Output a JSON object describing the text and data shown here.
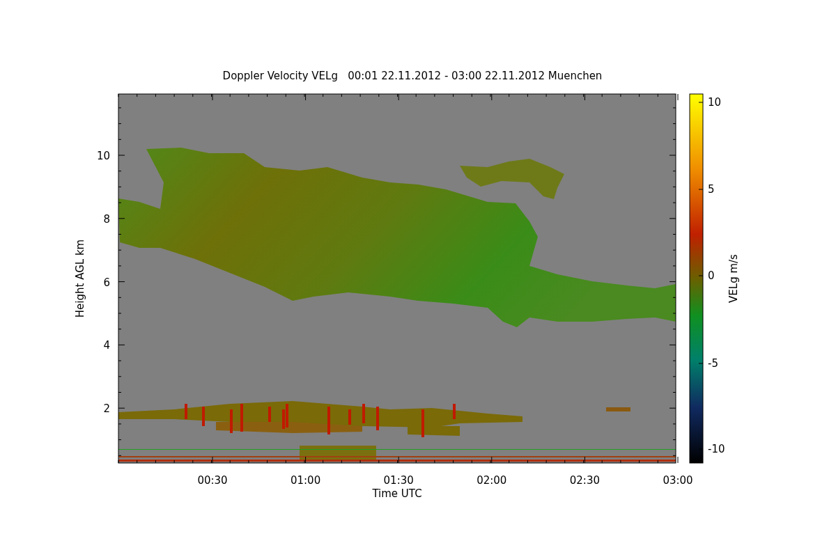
{
  "title": "Doppler Velocity VELg   00:01 22.11.2012 - 03:00 22.11.2012 Muenchen",
  "y_axis": {
    "label": "Height AGL km",
    "ticks": [
      "10",
      "8",
      "6",
      "4",
      "2"
    ]
  },
  "x_axis": {
    "label": "Time UTC",
    "ticks": [
      "00:30",
      "01:00",
      "01:30",
      "02:00",
      "02:30",
      "03:00"
    ]
  },
  "colorbar": {
    "label": "VELg m/s",
    "ticks": [
      "10",
      "5",
      "0",
      "-5",
      "-10"
    ]
  }
}
